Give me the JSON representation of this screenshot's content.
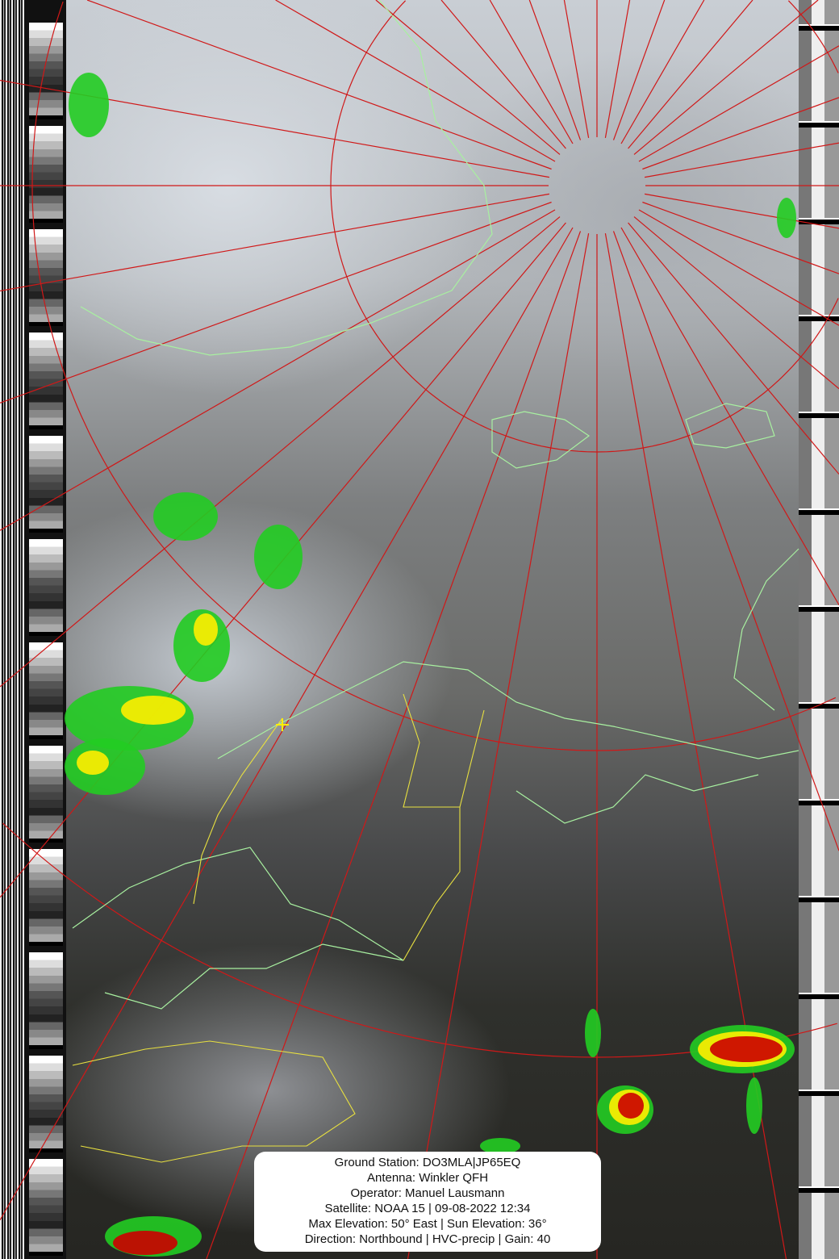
{
  "info": {
    "ground_station": "Ground Station: DO3MLA|JP65EQ",
    "antenna": "Antenna: Winkler QFH",
    "operator": "Operator: Manuel Lausmann",
    "satellite": "Satellite: NOAA 15 | 09-08-2022 12:34",
    "elevation": "Max Elevation: 50° East | Sun Elevation: 36°",
    "direction": "Direction: Northbound | HVC-precip | Gain: 40"
  },
  "colors": {
    "grid": "#d01818",
    "coastline": "#a8f0a0",
    "borders": "#e8e040",
    "precip_low": "#22cc22",
    "precip_mid": "#ffee00",
    "precip_high": "#cc0000"
  }
}
